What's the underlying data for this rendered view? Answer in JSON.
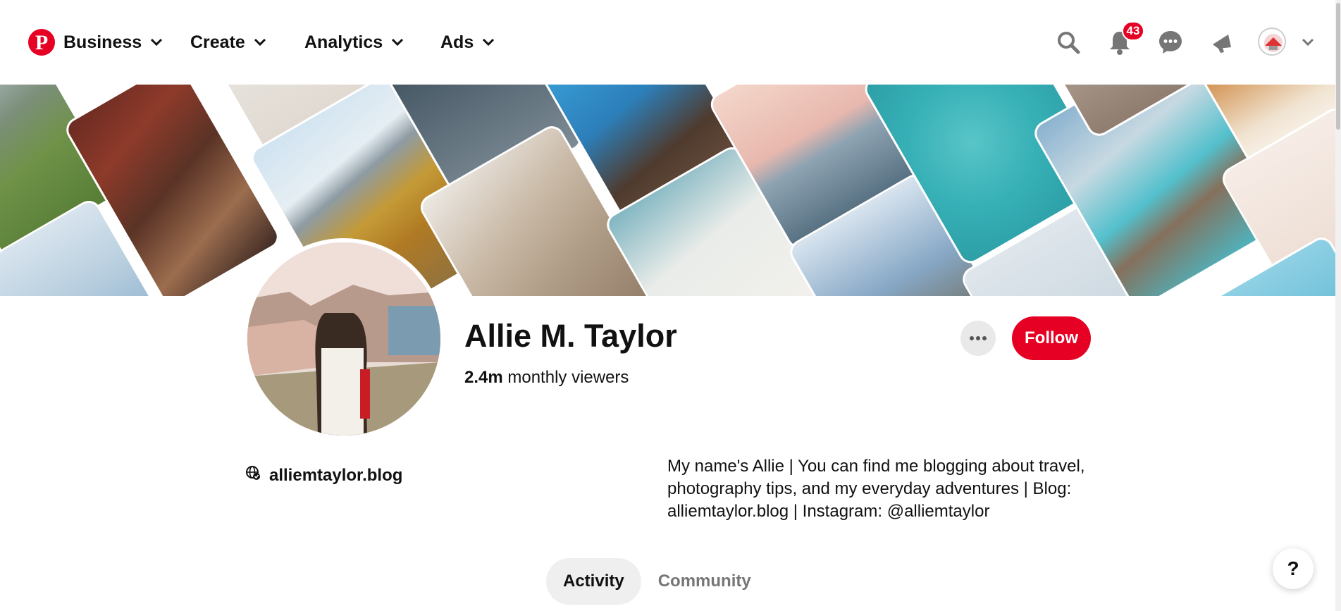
{
  "nav": {
    "logo_icon": "pinterest-logo-icon",
    "menus": [
      {
        "label": "Business"
      },
      {
        "label": "Create"
      },
      {
        "label": "Analytics"
      },
      {
        "label": "Ads"
      }
    ],
    "notifications_count": "43",
    "icons": [
      "search-icon",
      "bell-icon",
      "chat-icon",
      "megaphone-icon",
      "account-avatar",
      "chevron-down-icon"
    ]
  },
  "profile": {
    "name": "Allie M. Taylor",
    "viewers_count": "2.4m",
    "viewers_label": " monthly viewers",
    "website": "alliemtaylor.blog",
    "bio": "My name's Allie | You can find me blogging about travel, photography tips, and my everyday adventures | Blog: alliemtaylor.blog | Instagram: @alliemtaylor",
    "follow_label": "Follow"
  },
  "tabs": [
    {
      "label": "Activity",
      "active": true
    },
    {
      "label": "Community",
      "active": false
    }
  ],
  "help_label": "?",
  "colors": {
    "brand_red": "#e60023",
    "text": "#111111",
    "muted": "#767676",
    "tab_bg": "#efefef"
  }
}
